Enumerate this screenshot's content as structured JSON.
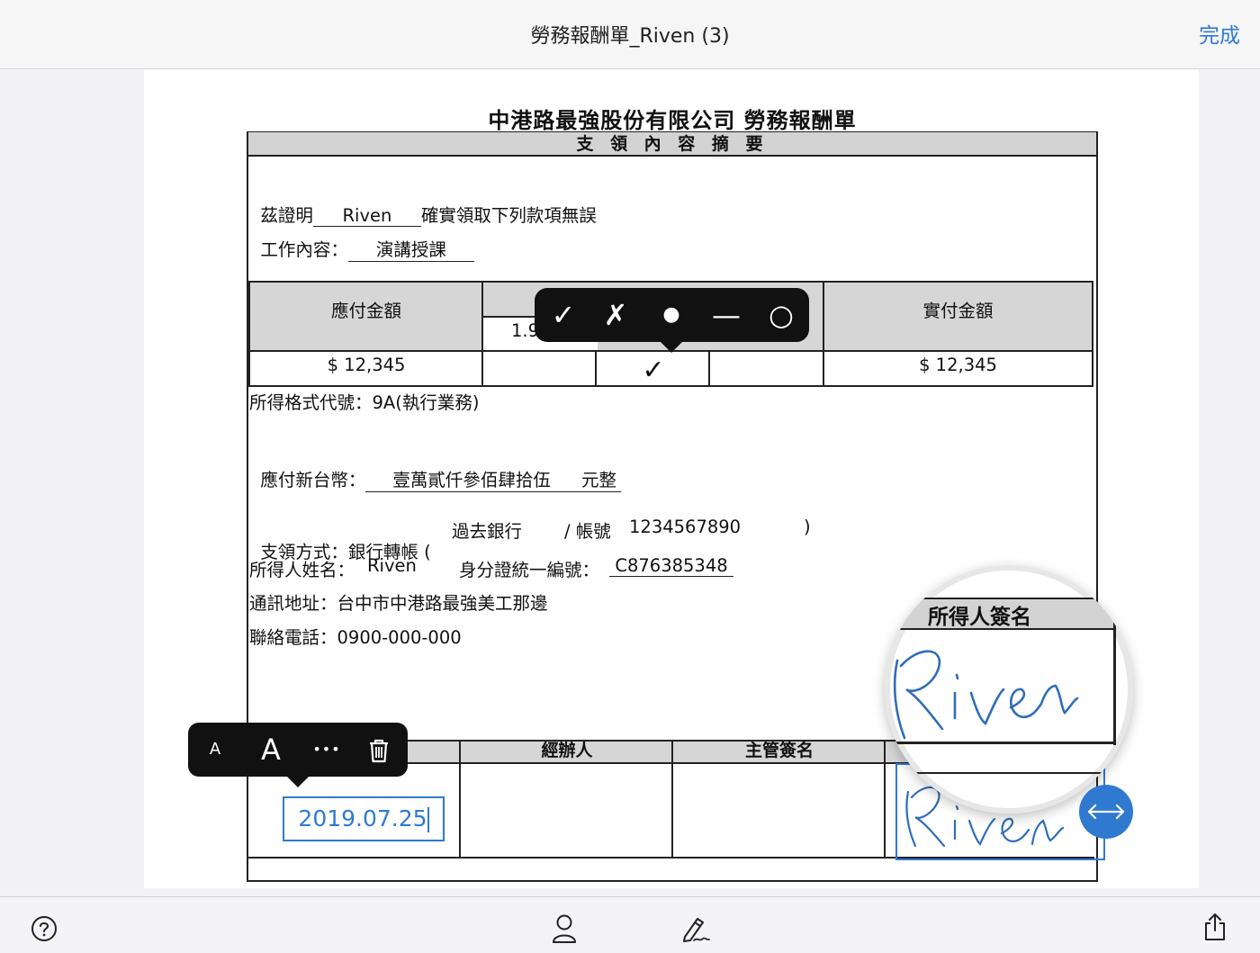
{
  "header": {
    "title": "勞務報酬單_Riven (3)",
    "done_label": "完成"
  },
  "form": {
    "title": "中港路最強股份有限公司 勞務報酬單",
    "section_header": "支 領 內 容 摘 要",
    "certify_prefix": "茲證明",
    "certify_name": "Riven",
    "certify_suffix": "確實領取下列款項無誤",
    "work_label": "工作內容：",
    "work_value": "演講授課",
    "amount_table": {
      "payable_header": "應付金額",
      "actual_header": "實付金額",
      "partial_value": "1.9",
      "payable_value": "$ 12,345",
      "actual_value": "$ 12,345",
      "check_mark": "✓"
    },
    "income_code": "所得格式代號：9A(執行業務)",
    "ntd_label": "應付新台幣：",
    "ntd_value": "壹萬貳仟參佰肆拾伍",
    "ntd_suffix": "元整",
    "payment": {
      "label": "支領方式：銀行轉帳 (",
      "bank": "過去銀行",
      "account_label": "/ 帳號",
      "account": "1234567890",
      "close": ")"
    },
    "recipient_label": "所得人姓名：",
    "recipient_name": "Riven",
    "id_label": "身分證統一編號：",
    "id_value": "C876385348",
    "address": "通訊地址：台中市中港路最強美工那邊",
    "phone": "聯絡電話：0900-000-000",
    "signature_table": {
      "handler_header": "經辦人",
      "supervisor_header": "主管簽名",
      "recipient_sign_header": "所得人簽名",
      "date_value": "2019.07.25",
      "signature_text": "Riven"
    }
  },
  "mark_toolbar": {
    "check": "✓",
    "cross": "✗",
    "dot": "●",
    "dash": "—",
    "circle": "○"
  },
  "text_toolbar": {
    "small_font": "A",
    "large_font": "A",
    "more": "•••"
  },
  "colors": {
    "accent": "#2f7ad0",
    "toolbar_bg": "#111111",
    "header_gray": "#d3d3d3"
  },
  "icons": {
    "help": "help-icon",
    "person": "person-icon",
    "signature": "signature-icon",
    "share": "share-icon",
    "trash": "trash-icon",
    "resize": "resize-horizontal-icon"
  }
}
